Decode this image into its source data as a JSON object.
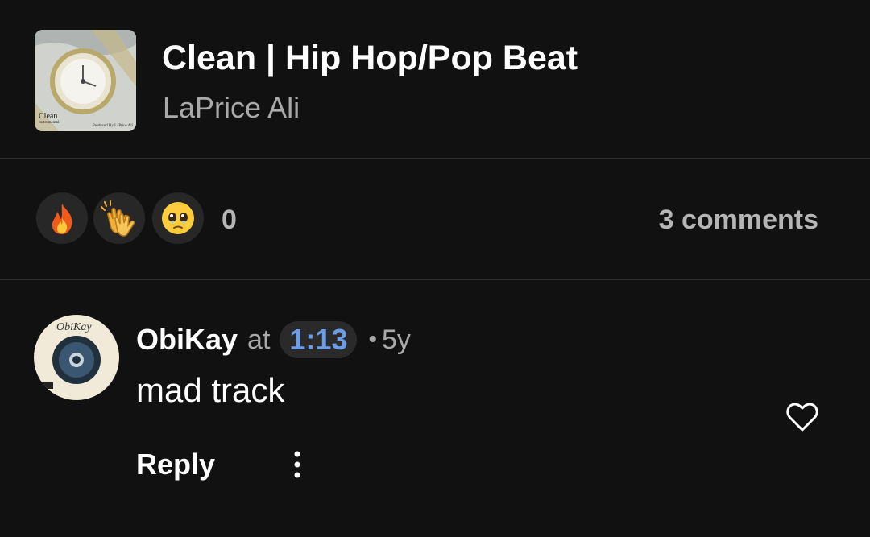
{
  "track": {
    "title": "Clean | Hip Hop/Pop Beat",
    "artist": "LaPrice Ali",
    "artwork_caption": "Clean",
    "artwork_caption_sub": "Instrumental",
    "artwork_credit": "Produced By LaPrice Ali"
  },
  "reactions": {
    "items": [
      {
        "icon": "fire-icon",
        "glyph": "🔥"
      },
      {
        "icon": "clapping-hands-icon",
        "glyph": "👏"
      },
      {
        "icon": "pleading-face-icon",
        "glyph": "🥹"
      }
    ],
    "count": "0",
    "comments_label": "3 comments"
  },
  "comment": {
    "username": "ObiKay",
    "at_label": "at",
    "timestamp": "1:13",
    "separator": "•",
    "age": "5y",
    "text": "mad track",
    "reply_label": "Reply",
    "avatar_script": "ObiKay"
  },
  "colors": {
    "background": "#111111",
    "timestamp_accent": "#6c9ee8",
    "muted_text": "#a9a9a9"
  }
}
